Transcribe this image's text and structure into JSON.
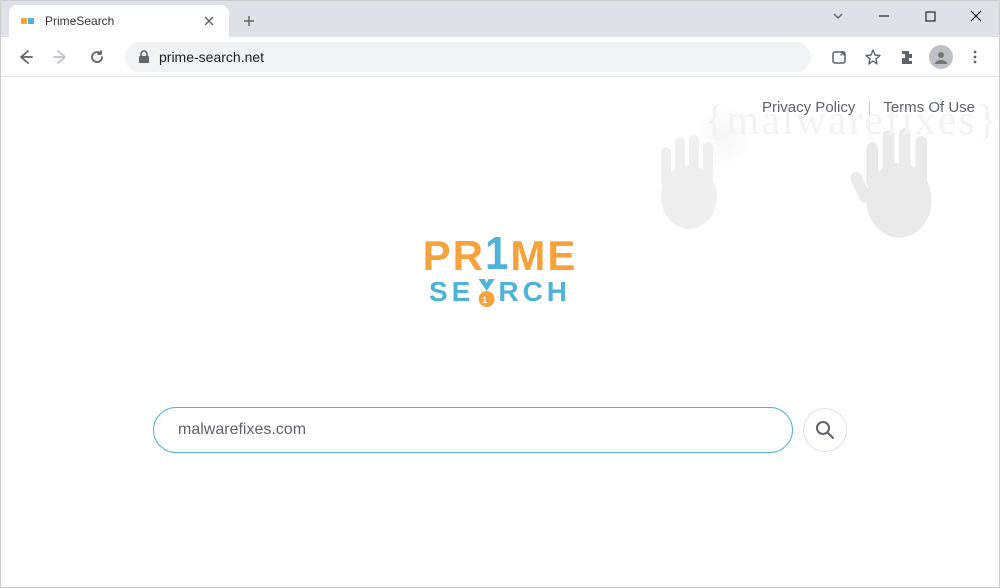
{
  "tab": {
    "title": "PrimeSearch"
  },
  "url": "prime-search.net",
  "header": {
    "privacy": "Privacy Policy",
    "terms": "Terms Of Use",
    "separator": "|"
  },
  "logo": {
    "pr": "PR",
    "one": "1",
    "me": "ME",
    "se": "SE",
    "rch": "RCH"
  },
  "search": {
    "value": "malwarefixes.com"
  },
  "watermark": "{malwarefixes}"
}
